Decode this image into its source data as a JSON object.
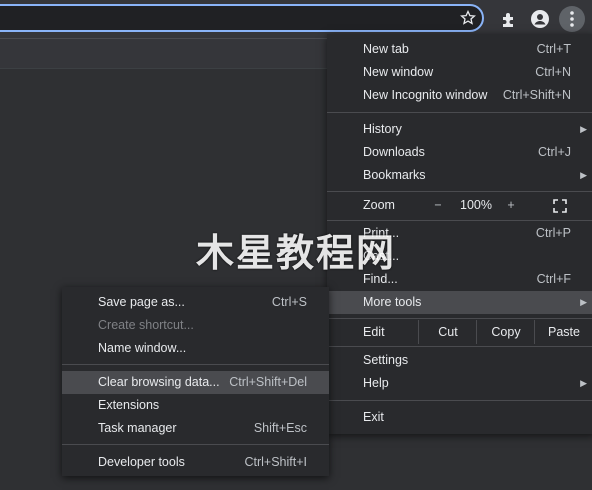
{
  "toolbar": {
    "star_icon": "star-outline-icon",
    "extension_icon": "puzzle-icon",
    "profile_icon": "person-icon",
    "menu_icon": "three-dots-vertical-icon"
  },
  "menu": {
    "new_tab": {
      "label": "New tab",
      "shortcut": "Ctrl+T"
    },
    "new_window": {
      "label": "New window",
      "shortcut": "Ctrl+N"
    },
    "new_incognito": {
      "label": "New Incognito window",
      "shortcut": "Ctrl+Shift+N"
    },
    "history": {
      "label": "History"
    },
    "downloads": {
      "label": "Downloads",
      "shortcut": "Ctrl+J"
    },
    "bookmarks": {
      "label": "Bookmarks"
    },
    "zoom": {
      "label": "Zoom",
      "minus": "−",
      "value": "100%",
      "plus": "+"
    },
    "print": {
      "label": "Print...",
      "shortcut": "Ctrl+P"
    },
    "cast": {
      "label": "Cast..."
    },
    "find": {
      "label": "Find...",
      "shortcut": "Ctrl+F"
    },
    "more_tools": {
      "label": "More tools"
    },
    "edit": {
      "label": "Edit",
      "cut": "Cut",
      "copy": "Copy",
      "paste": "Paste"
    },
    "settings": {
      "label": "Settings"
    },
    "help": {
      "label": "Help"
    },
    "exit": {
      "label": "Exit"
    }
  },
  "submenu": {
    "save_page": {
      "label": "Save page as...",
      "shortcut": "Ctrl+S"
    },
    "create_shortcut": {
      "label": "Create shortcut..."
    },
    "name_window": {
      "label": "Name window..."
    },
    "clear_browsing": {
      "label": "Clear browsing data...",
      "shortcut": "Ctrl+Shift+Del"
    },
    "extensions": {
      "label": "Extensions"
    },
    "task_manager": {
      "label": "Task manager",
      "shortcut": "Shift+Esc"
    },
    "developer_tools": {
      "label": "Developer tools",
      "shortcut": "Ctrl+Shift+I"
    }
  },
  "watermark": "木星教程网",
  "colors": {
    "omnibox_border": "#8ab4f8",
    "menu_bg": "#292a2d",
    "highlight": "#4a4b4f"
  }
}
